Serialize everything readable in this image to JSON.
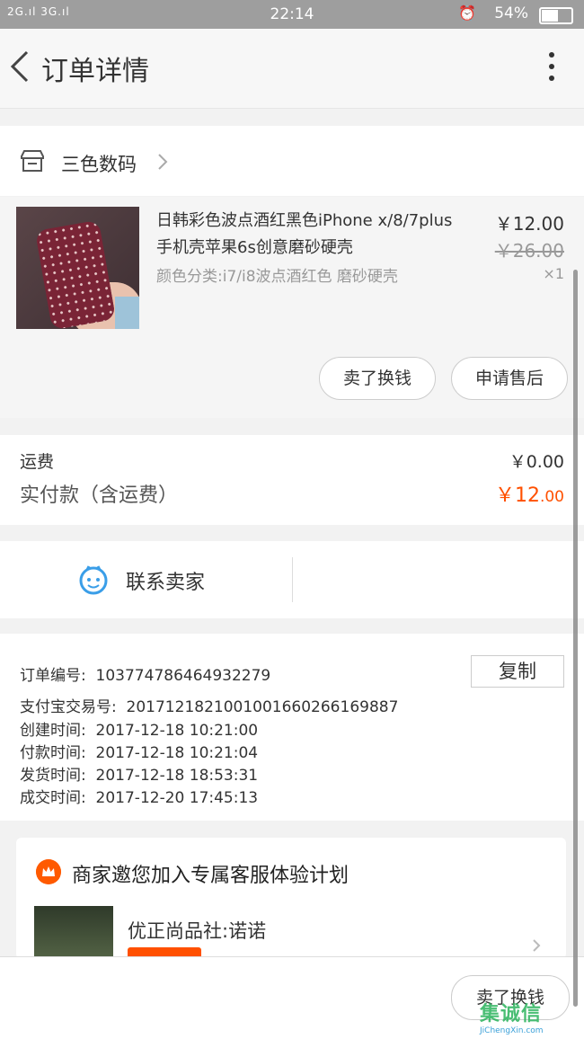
{
  "status": {
    "signal": "2G.ıl 3G.ıl",
    "time": "22:14",
    "battery": "54%"
  },
  "header": {
    "title": "订单详情"
  },
  "shop": {
    "name": "三色数码"
  },
  "item": {
    "title": "日韩彩色波点酒红黑色iPhone x/8/7plus手机壳苹果6s创意磨砂硬壳",
    "sku": "颜色分类:i7/i8波点酒红色 磨砂硬壳",
    "price": "￥12.00",
    "original_price": "￥26.00",
    "quantity": "×1",
    "buttons": {
      "sell": "卖了换钱",
      "aftersale": "申请售后"
    }
  },
  "fees": {
    "shipping_label": "运费",
    "shipping_value": "￥0.00",
    "paid_label": "实付款（含运费）",
    "paid_main": "￥12",
    "paid_decimal": ".00"
  },
  "contact": {
    "label": "联系卖家"
  },
  "order_info": {
    "order_no_label": "订单编号:",
    "order_no": "103774786464932279",
    "copy": "复制",
    "alipay_label": "支付宝交易号:",
    "alipay_no": "2017121821001001660266169887",
    "created_label": "创建时间:",
    "created": "2017-12-18 10:21:00",
    "paid_label": "付款时间:",
    "paid": "2017-12-18 10:21:04",
    "shipped_label": "发货时间:",
    "shipped": "2017-12-18 18:53:31",
    "done_label": "成交时间:",
    "done": "2017-12-20 17:45:13"
  },
  "promo": {
    "title": "商家邀您加入专属客服体验计划",
    "seller": "优正尚品社:诺诺"
  },
  "bottom": {
    "sell": "卖了换钱"
  },
  "watermark": {
    "text": "集诚信",
    "sub": "JiChengXin.com"
  },
  "colors": {
    "accent": "#ff5000",
    "contact_blue": "#3a9ee8"
  }
}
